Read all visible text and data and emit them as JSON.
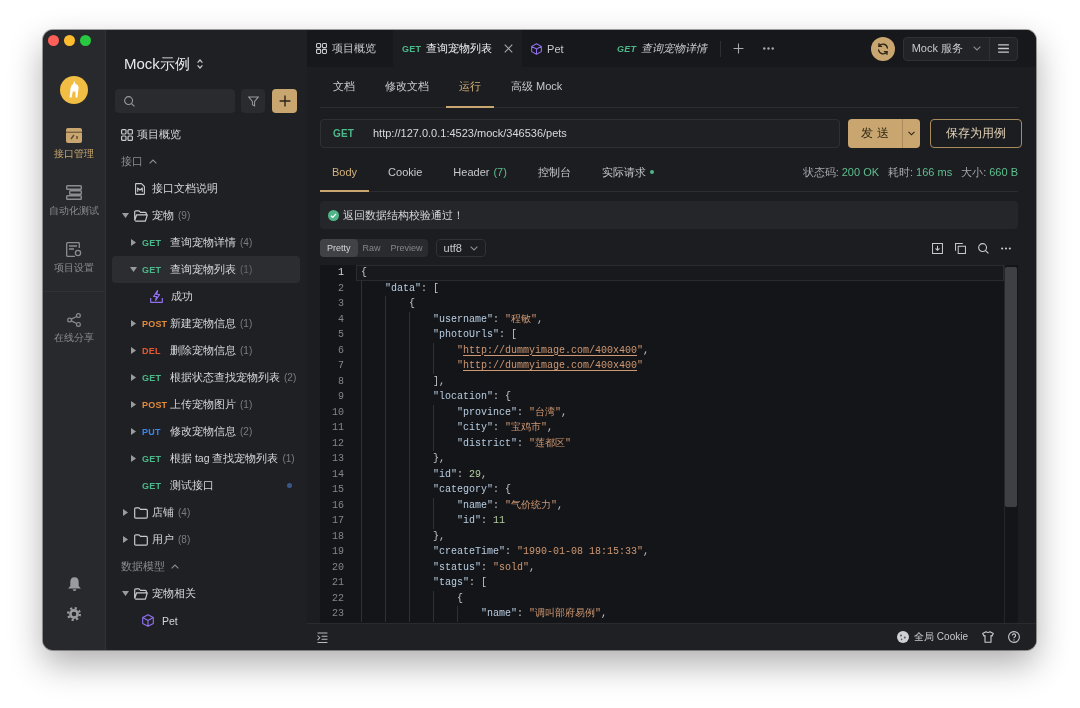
{
  "rail": {
    "items": [
      {
        "kind": "apis",
        "label": "接口管理",
        "selected": true
      },
      {
        "kind": "tests",
        "label": "自动化测试",
        "selected": false
      },
      {
        "kind": "settings",
        "label": "项目设置",
        "selected": false
      },
      {
        "kind": "share",
        "label": "在线分享",
        "selected": false
      }
    ]
  },
  "sidebar": {
    "project": "Mock示例",
    "overview": {
      "label": "项目概览",
      "selected": false
    },
    "sections": [
      {
        "title": "接口",
        "expanded": true,
        "items": [
          {
            "kind": "doc",
            "label": "接口文档说明",
            "selected": false
          },
          {
            "kind": "folder",
            "label": "宠物",
            "count": "(9)",
            "expanded": true,
            "selected": false,
            "children": [
              {
                "kind": "endpoint",
                "method": "GET",
                "color": "#4cb98a",
                "label": "查询宠物详情",
                "count": "(4)",
                "expanded": false,
                "modified": false,
                "selected": false
              },
              {
                "kind": "endpoint",
                "method": "GET",
                "color": "#4cb98a",
                "label": "查询宠物列表",
                "count": "(1)",
                "expanded": true,
                "modified": false,
                "selected": true,
                "children": [
                  {
                    "kind": "case",
                    "label": "成功",
                    "selected": false
                  }
                ]
              },
              {
                "kind": "endpoint",
                "method": "POST",
                "color": "#e38b3d",
                "label": "新建宠物信息",
                "count": "(1)",
                "expanded": false,
                "modified": false,
                "selected": false
              },
              {
                "kind": "endpoint",
                "method": "DEL",
                "color": "#e6592e",
                "label": "删除宠物信息",
                "count": "(1)",
                "expanded": false,
                "modified": false,
                "selected": false
              },
              {
                "kind": "endpoint",
                "method": "GET",
                "color": "#4cb98a",
                "label": "根据状态查找宠物列表",
                "count": "(2)",
                "expanded": false,
                "modified": false,
                "selected": false
              },
              {
                "kind": "endpoint",
                "method": "POST",
                "color": "#e38b3d",
                "label": "上传宠物图片",
                "count": "(1)",
                "expanded": false,
                "modified": false,
                "selected": false
              },
              {
                "kind": "endpoint",
                "method": "PUT",
                "color": "#3a85ea",
                "label": "修改宠物信息",
                "count": "(2)",
                "expanded": false,
                "modified": false,
                "selected": false
              },
              {
                "kind": "endpoint",
                "method": "GET",
                "color": "#4cb98a",
                "label": "根据 tag 查找宠物列表",
                "count": "(1)",
                "expanded": false,
                "modified": false,
                "selected": false
              },
              {
                "kind": "endpoint",
                "method": "GET",
                "color": "#4cb98a",
                "label": "测试接口",
                "modified": true,
                "selected": false
              }
            ]
          },
          {
            "kind": "folder",
            "label": "店铺",
            "count": "(4)",
            "expanded": false,
            "selected": false
          },
          {
            "kind": "folder",
            "label": "用户",
            "count": "(8)",
            "expanded": false,
            "selected": false
          }
        ]
      },
      {
        "title": "数据模型",
        "expanded": true,
        "items": [
          {
            "kind": "folder",
            "label": "宠物相关",
            "expanded": true,
            "selected": false,
            "children": [
              {
                "kind": "schema",
                "label": "Pet",
                "selected": false
              }
            ]
          }
        ]
      }
    ]
  },
  "tabs": [
    {
      "kind": "overview",
      "label": "项目概览",
      "selected": false,
      "preview": false
    },
    {
      "kind": "endpoint",
      "method": "GET",
      "color": "#4cb98a",
      "label": "查询宠物列表",
      "selected": true,
      "preview": false
    },
    {
      "kind": "schema",
      "label": "Pet",
      "selected": false,
      "preview": false
    },
    {
      "kind": "endpoint",
      "method": "GET",
      "color": "#4cb98a",
      "label": "查询宠物详情",
      "selected": false,
      "preview": true
    }
  ],
  "mock_service": {
    "label": "Mock 服务"
  },
  "doc_tabs": [
    {
      "label": "文档",
      "selected": false
    },
    {
      "label": "修改文档",
      "selected": false
    },
    {
      "label": "运行",
      "selected": true
    },
    {
      "label": "高级 Mock",
      "selected": false
    }
  ],
  "request": {
    "method": "GET",
    "color": "#4cb98a",
    "url": "http://127.0.0.1:4523/mock/346536/pets",
    "send": "发 送",
    "save": "保存为用例"
  },
  "response": {
    "tabs": [
      {
        "label": "Body",
        "selected": true,
        "indicator": false
      },
      {
        "label": "Cookie",
        "selected": false,
        "indicator": false
      },
      {
        "label": "Header",
        "count": "(7)",
        "selected": false,
        "indicator": false
      },
      {
        "label": "控制台",
        "selected": false,
        "indicator": false
      },
      {
        "label": "实际请求",
        "selected": false,
        "indicator": true
      }
    ],
    "meta": [
      {
        "label": "状态码:",
        "value": "200 OK"
      },
      {
        "label": "耗时:",
        "value": "166 ms"
      },
      {
        "label": "大小:",
        "value": "660 B"
      }
    ],
    "validation": {
      "passed": true,
      "message": "返回数据结构校验通过！"
    },
    "view_modes": [
      {
        "label": "Pretty",
        "selected": true
      },
      {
        "label": "Raw",
        "selected": false
      },
      {
        "label": "Preview",
        "selected": false
      }
    ],
    "encoding": "utf8",
    "code": [
      {
        "number": "1",
        "current": true,
        "tokens": [
          {
            "kind": "punct",
            "text": "{"
          }
        ],
        "children": [
          {
            "number": "2",
            "current": false,
            "tokens": [
              {
                "kind": "key",
                "text": "\"data\""
              },
              {
                "kind": "punct",
                "text": ": ["
              }
            ],
            "children": [
              {
                "number": "3",
                "current": false,
                "tokens": [
                  {
                    "kind": "punct",
                    "text": "{"
                  }
                ],
                "children": [
                  {
                    "number": "4",
                    "current": false,
                    "tokens": [
                      {
                        "kind": "key",
                        "text": "\"username\""
                      },
                      {
                        "kind": "punct",
                        "text": ": "
                      },
                      {
                        "kind": "string",
                        "text": "\"程敏\""
                      },
                      {
                        "kind": "punct",
                        "text": ","
                      }
                    ]
                  },
                  {
                    "number": "5",
                    "current": false,
                    "tokens": [
                      {
                        "kind": "key",
                        "text": "\"photoUrls\""
                      },
                      {
                        "kind": "punct",
                        "text": ": ["
                      }
                    ],
                    "children": [
                      {
                        "number": "6",
                        "current": false,
                        "tokens": [
                          {
                            "kind": "string",
                            "text": "\""
                          },
                          {
                            "kind": "link",
                            "text": "http://dummyimage.com/400x400"
                          },
                          {
                            "kind": "string",
                            "text": "\""
                          },
                          {
                            "kind": "punct",
                            "text": ","
                          }
                        ]
                      },
                      {
                        "number": "7",
                        "current": false,
                        "tokens": [
                          {
                            "kind": "string",
                            "text": "\""
                          },
                          {
                            "kind": "link",
                            "text": "http://dummyimage.com/400x400"
                          },
                          {
                            "kind": "string",
                            "text": "\""
                          }
                        ]
                      }
                    ]
                  },
                  {
                    "number": "8",
                    "current": false,
                    "tokens": [
                      {
                        "kind": "punct",
                        "text": "],"
                      }
                    ]
                  },
                  {
                    "number": "9",
                    "current": false,
                    "tokens": [
                      {
                        "kind": "key",
                        "text": "\"location\""
                      },
                      {
                        "kind": "punct",
                        "text": ": {"
                      }
                    ],
                    "children": [
                      {
                        "number": "10",
                        "current": false,
                        "tokens": [
                          {
                            "kind": "key",
                            "text": "\"province\""
                          },
                          {
                            "kind": "punct",
                            "text": ": "
                          },
                          {
                            "kind": "string",
                            "text": "\"台湾\""
                          },
                          {
                            "kind": "punct",
                            "text": ","
                          }
                        ]
                      },
                      {
                        "number": "11",
                        "current": false,
                        "tokens": [
                          {
                            "kind": "key",
                            "text": "\"city\""
                          },
                          {
                            "kind": "punct",
                            "text": ": "
                          },
                          {
                            "kind": "string",
                            "text": "\"宝鸡市\""
                          },
                          {
                            "kind": "punct",
                            "text": ","
                          }
                        ]
                      },
                      {
                        "number": "12",
                        "current": false,
                        "tokens": [
                          {
                            "kind": "key",
                            "text": "\"district\""
                          },
                          {
                            "kind": "punct",
                            "text": ": "
                          },
                          {
                            "kind": "string",
                            "text": "\"莲都区\""
                          }
                        ]
                      }
                    ]
                  },
                  {
                    "number": "13",
                    "current": false,
                    "tokens": [
                      {
                        "kind": "punct",
                        "text": "},"
                      }
                    ]
                  },
                  {
                    "number": "14",
                    "current": false,
                    "tokens": [
                      {
                        "kind": "key",
                        "text": "\"id\""
                      },
                      {
                        "kind": "punct",
                        "text": ": "
                      },
                      {
                        "kind": "number",
                        "text": "29"
                      },
                      {
                        "kind": "punct",
                        "text": ","
                      }
                    ]
                  },
                  {
                    "number": "15",
                    "current": false,
                    "tokens": [
                      {
                        "kind": "key",
                        "text": "\"category\""
                      },
                      {
                        "kind": "punct",
                        "text": ": {"
                      }
                    ],
                    "children": [
                      {
                        "number": "16",
                        "current": false,
                        "tokens": [
                          {
                            "kind": "key",
                            "text": "\"name\""
                          },
                          {
                            "kind": "punct",
                            "text": ": "
                          },
                          {
                            "kind": "string",
                            "text": "\"气价统力\""
                          },
                          {
                            "kind": "punct",
                            "text": ","
                          }
                        ]
                      },
                      {
                        "number": "17",
                        "current": false,
                        "tokens": [
                          {
                            "kind": "key",
                            "text": "\"id\""
                          },
                          {
                            "kind": "punct",
                            "text": ": "
                          },
                          {
                            "kind": "number",
                            "text": "11"
                          }
                        ]
                      }
                    ]
                  },
                  {
                    "number": "18",
                    "current": false,
                    "tokens": [
                      {
                        "kind": "punct",
                        "text": "},"
                      }
                    ]
                  },
                  {
                    "number": "19",
                    "current": false,
                    "tokens": [
                      {
                        "kind": "key",
                        "text": "\"createTime\""
                      },
                      {
                        "kind": "punct",
                        "text": ": "
                      },
                      {
                        "kind": "string",
                        "text": "\"1990-01-08 18:15:33\""
                      },
                      {
                        "kind": "punct",
                        "text": ","
                      }
                    ]
                  },
                  {
                    "number": "20",
                    "current": false,
                    "tokens": [
                      {
                        "kind": "key",
                        "text": "\"status\""
                      },
                      {
                        "kind": "punct",
                        "text": ": "
                      },
                      {
                        "kind": "string",
                        "text": "\"sold\""
                      },
                      {
                        "kind": "punct",
                        "text": ","
                      }
                    ]
                  },
                  {
                    "number": "21",
                    "current": false,
                    "tokens": [
                      {
                        "kind": "key",
                        "text": "\"tags\""
                      },
                      {
                        "kind": "punct",
                        "text": ": ["
                      }
                    ],
                    "children": [
                      {
                        "number": "22",
                        "current": false,
                        "tokens": [
                          {
                            "kind": "punct",
                            "text": "{"
                          }
                        ],
                        "children": [
                          {
                            "number": "23",
                            "current": false,
                            "tokens": [
                              {
                                "kind": "key",
                                "text": "\"name\""
                              },
                              {
                                "kind": "punct",
                                "text": ": "
                              },
                              {
                                "kind": "string",
                                "text": "\"调叫部府易例\""
                              },
                              {
                                "kind": "punct",
                                "text": ","
                              }
                            ]
                          }
                        ]
                      }
                    ]
                  }
                ]
              }
            ]
          }
        ]
      }
    ]
  },
  "status_bar": {
    "cookie": "全局 Cookie"
  }
}
